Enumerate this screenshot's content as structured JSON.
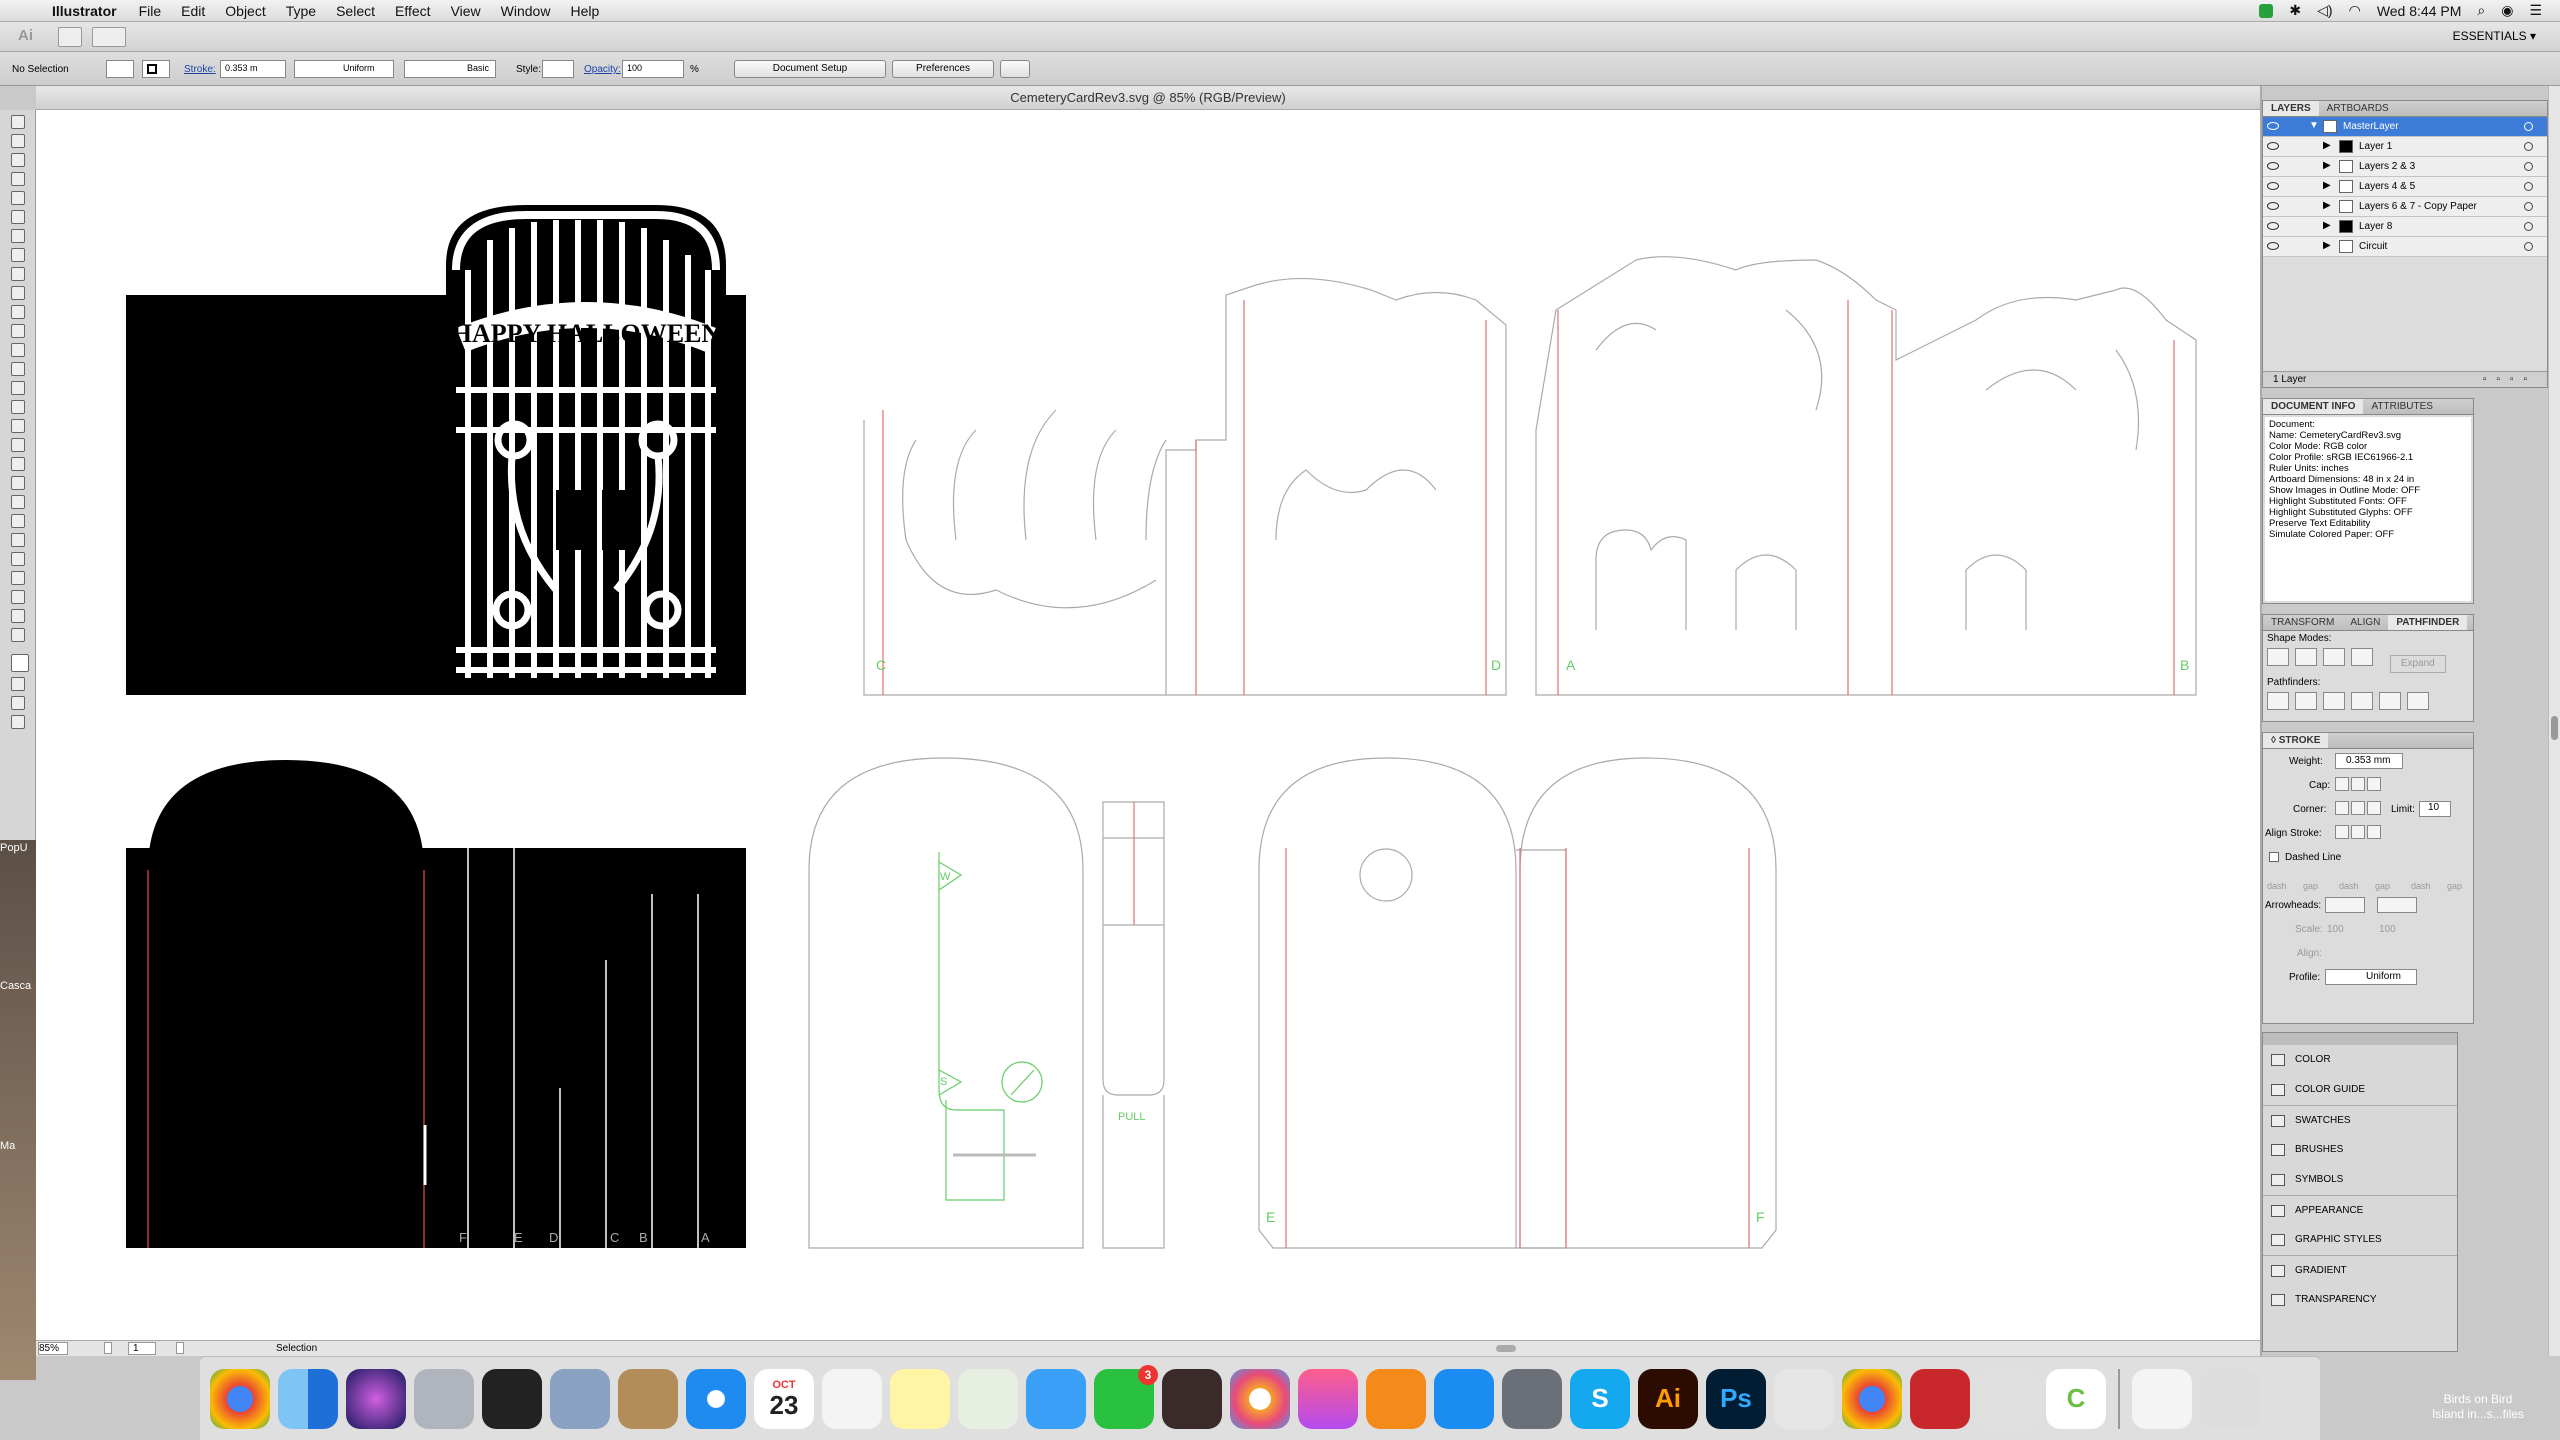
{
  "menubar": {
    "app_name": "Illustrator",
    "items": [
      "File",
      "Edit",
      "Object",
      "Type",
      "Select",
      "Effect",
      "View",
      "Window",
      "Help"
    ],
    "clock": "Wed 8:44 PM"
  },
  "appbar": {
    "logo": "Ai",
    "workspace": "ESSENTIALS ▾"
  },
  "control": {
    "selection": "No Selection",
    "stroke_label": "Stroke:",
    "stroke_value": "0.353 m",
    "uniform": "Uniform",
    "basic": "Basic",
    "style_label": "Style:",
    "opacity_label": "Opacity:",
    "opacity_value": "100",
    "percent": "%",
    "document_setup": "Document Setup",
    "preferences": "Preferences"
  },
  "document": {
    "title": "CemeteryCardRev3.svg @ 85% (RGB/Preview)"
  },
  "canvas": {
    "gate_text": "HAPPY HALLOWEEN",
    "letters_top": [
      "C",
      "D",
      "A",
      "B"
    ],
    "letters_bottom_left": [
      "F",
      "E",
      "D",
      "C",
      "B",
      "A"
    ],
    "tab_labels": [
      "W",
      "S"
    ],
    "pull_label": "PULL",
    "letters_bottom_right": [
      "E",
      "F"
    ]
  },
  "statusbar": {
    "zoom": "85%",
    "page": "1",
    "tool": "Selection"
  },
  "layers": {
    "tabs": [
      "LAYERS",
      "ARTBOARDS"
    ],
    "rows": [
      {
        "name": "MasterLayer",
        "selected": true
      },
      {
        "name": "Layer 1"
      },
      {
        "name": "Layers 2 & 3"
      },
      {
        "name": "Layers 4 & 5"
      },
      {
        "name": "Layers 6 & 7 - Copy Paper"
      },
      {
        "name": "Layer 8"
      },
      {
        "name": "Circuit"
      }
    ],
    "footer": "1 Layer"
  },
  "docinfo": {
    "tabs": [
      "DOCUMENT INFO",
      "ATTRIBUTES"
    ],
    "lines": [
      "Document:",
      "",
      "Name: CemeteryCardRev3.svg",
      "",
      "Color Mode: RGB color",
      "Color Profile: sRGB IEC61966-2.1",
      "Ruler Units: inches",
      "Artboard Dimensions: 48 in x 24 in",
      "Show Images in Outline Mode: OFF",
      "Highlight Substituted Fonts: OFF",
      "Highlight Substituted Glyphs: OFF",
      "Preserve Text Editability",
      "Simulate Colored Paper: OFF"
    ]
  },
  "pathfinder": {
    "tabs": [
      "TRANSFORM",
      "ALIGN",
      "PATHFINDER"
    ],
    "shape_modes": "Shape Modes:",
    "expand": "Expand",
    "pathfinders": "Pathfinders:"
  },
  "stroke": {
    "title": "◊ STROKE",
    "weight_label": "Weight:",
    "weight_value": "0.353 mm",
    "cap_label": "Cap:",
    "corner_label": "Corner:",
    "limit_label": "Limit:",
    "limit_value": "10",
    "align_label": "Align Stroke:",
    "dashed": "Dashed Line",
    "dash_labels": [
      "dash",
      "gap",
      "dash",
      "gap",
      "dash",
      "gap"
    ],
    "arrowheads": "Arrowheads:",
    "scale": "Scale:",
    "scale_a": "100",
    "scale_b": "100",
    "align": "Align:",
    "profile_label": "Profile:",
    "profile_value": "Uniform"
  },
  "side_panels": [
    "COLOR",
    "COLOR GUIDE",
    "SWATCHES",
    "BRUSHES",
    "SYMBOLS",
    "APPEARANCE",
    "GRAPHIC STYLES",
    "GRADIENT",
    "TRANSPARENCY"
  ],
  "left_strip": {
    "labels": [
      "PopU",
      "Casca",
      "Ma"
    ]
  },
  "dock": {
    "badge": "3",
    "calendar_month": "OCT",
    "calendar_day": "23",
    "desktop_label": "Birds on Bird\nIsland in...s...files"
  }
}
